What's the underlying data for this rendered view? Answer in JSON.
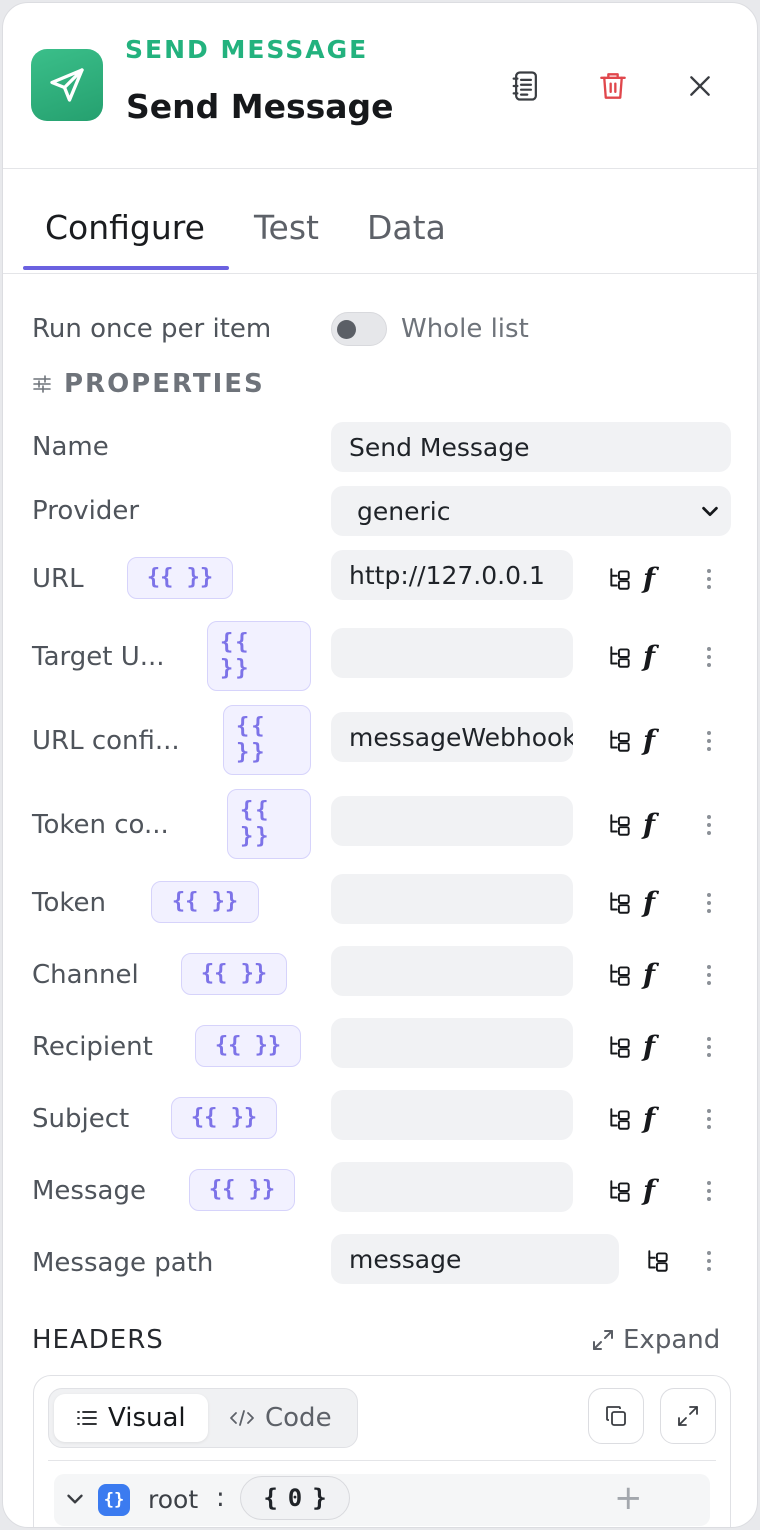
{
  "header": {
    "eyebrow": "SEND MESSAGE",
    "title": "Send Message",
    "icons": {
      "app": "send-icon",
      "docs": "document-icon",
      "delete": "trash-icon",
      "close": "close-icon"
    }
  },
  "tabs": [
    {
      "label": "Configure",
      "active": true
    },
    {
      "label": "Test",
      "active": false
    },
    {
      "label": "Data",
      "active": false
    }
  ],
  "run_mode": {
    "label": "Run once per item",
    "toggle_label": "Whole list",
    "enabled": false
  },
  "properties": {
    "heading": "PROPERTIES",
    "name": {
      "label": "Name",
      "value": "Send Message"
    },
    "provider": {
      "label": "Provider",
      "value": "generic"
    },
    "template_symbol": "{{ }}",
    "fields": [
      {
        "label": "URL",
        "value": "http://127.0.0.1"
      },
      {
        "label": "Target U...",
        "value": ""
      },
      {
        "label": "URL confi...",
        "value": "messageWebhook"
      },
      {
        "label": "Token co...",
        "value": ""
      },
      {
        "label": "Token",
        "value": ""
      },
      {
        "label": "Channel",
        "value": ""
      },
      {
        "label": "Recipient",
        "value": ""
      },
      {
        "label": "Subject",
        "value": ""
      },
      {
        "label": "Message",
        "value": ""
      }
    ],
    "message_path": {
      "label": "Message path",
      "value": "message"
    }
  },
  "headers": {
    "label": "HEADERS",
    "expand_label": "Expand",
    "modes": {
      "visual": "Visual",
      "code": "Code",
      "active": "visual"
    },
    "root_key": "root",
    "root_badge": "{}",
    "root_count": "0"
  },
  "colors": {
    "accent": "#6b61e0",
    "brand": "#2fb07e",
    "danger": "#e0474c",
    "template": "#7d73e8"
  }
}
